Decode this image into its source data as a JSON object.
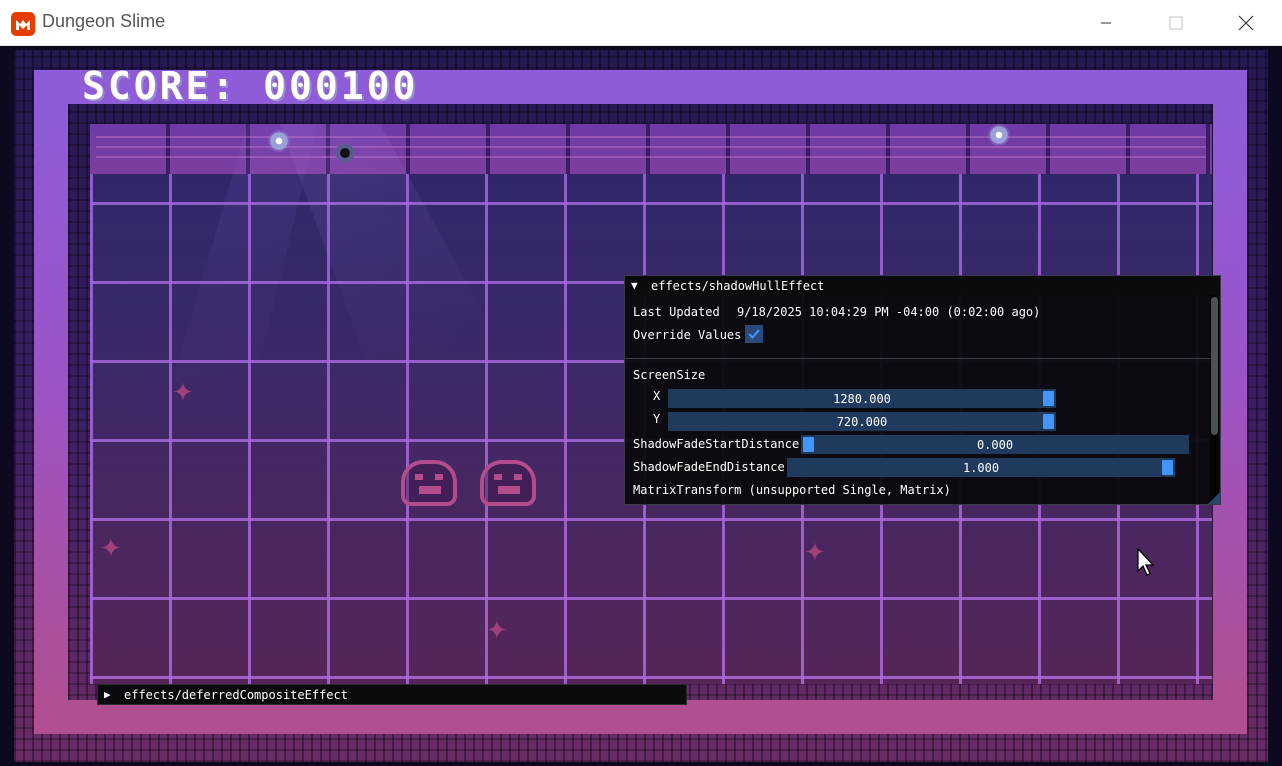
{
  "window": {
    "title": "Dungeon Slime",
    "app_icon": "monogame-logo-icon",
    "controls": {
      "minimize": "minimize-icon",
      "maximize": "maximize-icon",
      "close": "close-icon"
    }
  },
  "game": {
    "score_text": "SCORE: 000100"
  },
  "effect_panel": {
    "title": "effects/shadowHullEffect",
    "expanded": true,
    "last_updated_label": "Last Updated",
    "last_updated_value": "9/18/2025 10:04:29 PM -04:00 (0:02:00 ago)",
    "override_label": "Override Values",
    "override_checked": true,
    "screen_size_label": "ScreenSize",
    "screen_size": {
      "x_label": "X",
      "x_value": "1280.000",
      "x_fraction": 1.0,
      "y_label": "Y",
      "y_value": "720.000",
      "y_fraction": 1.0
    },
    "fade_start_label": "ShadowFadeStartDistance",
    "fade_start_value": "0.000",
    "fade_start_fraction": 0.0,
    "fade_end_label": "ShadowFadeEndDistance",
    "fade_end_value": "1.000",
    "fade_end_fraction": 1.0,
    "matrix_label": "MatrixTransform (unsupported Single, Matrix)"
  },
  "composite_panel": {
    "title": "effects/deferredCompositeEffect",
    "expanded": false
  },
  "colors": {
    "imgui_accent": "#4296fa",
    "imgui_frame": "#203a5e",
    "wall_purple": "#8e5cd9",
    "slime_pink": "#b34c8c"
  }
}
